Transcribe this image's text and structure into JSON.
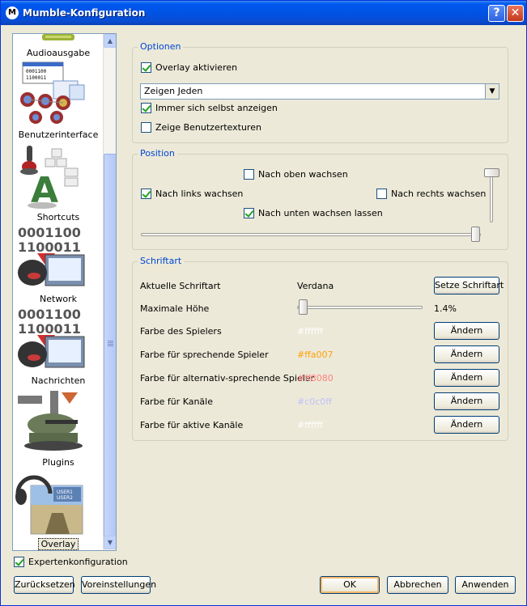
{
  "window": {
    "title": "Mumble-Konfiguration",
    "help_label": "?",
    "close_label": "✕"
  },
  "sidebar": {
    "items": [
      {
        "label": "Audioausgabe",
        "icon": "speaker-icon"
      },
      {
        "label": "Benutzerinterface",
        "icon": "ui-icon"
      },
      {
        "label": "Shortcuts",
        "icon": "joystick-icon"
      },
      {
        "label": "Network",
        "icon": "network-icon"
      },
      {
        "label": "Nachrichten",
        "icon": "messages-icon"
      },
      {
        "label": "Plugins",
        "icon": "plugins-icon"
      },
      {
        "label": "Overlay",
        "icon": "overlay-icon",
        "selected": true
      }
    ]
  },
  "optionen": {
    "title": "Optionen",
    "overlay_enable": {
      "label": "Overlay aktivieren",
      "checked": true
    },
    "show_select": {
      "value": "Zeigen Jeden"
    },
    "always_self": {
      "label": "Immer sich selbst anzeigen",
      "checked": true
    },
    "user_textures": {
      "label": "Zeige Benutzertexturen",
      "checked": false
    }
  },
  "position": {
    "title": "Position",
    "grow_up": {
      "label": "Nach oben wachsen",
      "checked": false
    },
    "grow_left": {
      "label": "Nach links wachsen",
      "checked": true
    },
    "grow_right": {
      "label": "Nach rechts wachsen",
      "checked": false
    },
    "grow_down": {
      "label": "Nach unten wachsen lassen",
      "checked": true
    },
    "horizontal_value": 1.0,
    "vertical_value": 1.0
  },
  "schriftart": {
    "title": "Schriftart",
    "current_font": {
      "label": "Aktuelle Schriftart",
      "value": "Verdana",
      "button": "Setze Schriftart"
    },
    "max_height": {
      "label": "Maximale Höhe",
      "value": "1.4%",
      "fraction": 0.02
    },
    "colors": [
      {
        "label": "Farbe des Spielers",
        "value": "#ffffff",
        "color": "#ffffff",
        "button": "Ändern"
      },
      {
        "label": "Farbe für sprechende Spieler",
        "value": "#ffa007",
        "color": "#ffa007",
        "button": "Ändern"
      },
      {
        "label": "Farbe für alternativ-sprechende Spieler",
        "value": "#ff8080",
        "color": "#ff8080",
        "button": "Ändern"
      },
      {
        "label": "Farbe für Kanäle",
        "value": "#c0c0ff",
        "color": "#c0c0ff",
        "button": "Ändern"
      },
      {
        "label": "Farbe für aktive Kanäle",
        "value": "#ffffff",
        "color": "#ffffff",
        "button": "Ändern"
      }
    ]
  },
  "footer": {
    "expert": {
      "label": "Expertenkonfiguration",
      "checked": true
    },
    "reset": "Zurücksetzen",
    "defaults": "Voreinstellungen",
    "ok": "OK",
    "cancel": "Abbrechen",
    "apply": "Anwenden"
  }
}
